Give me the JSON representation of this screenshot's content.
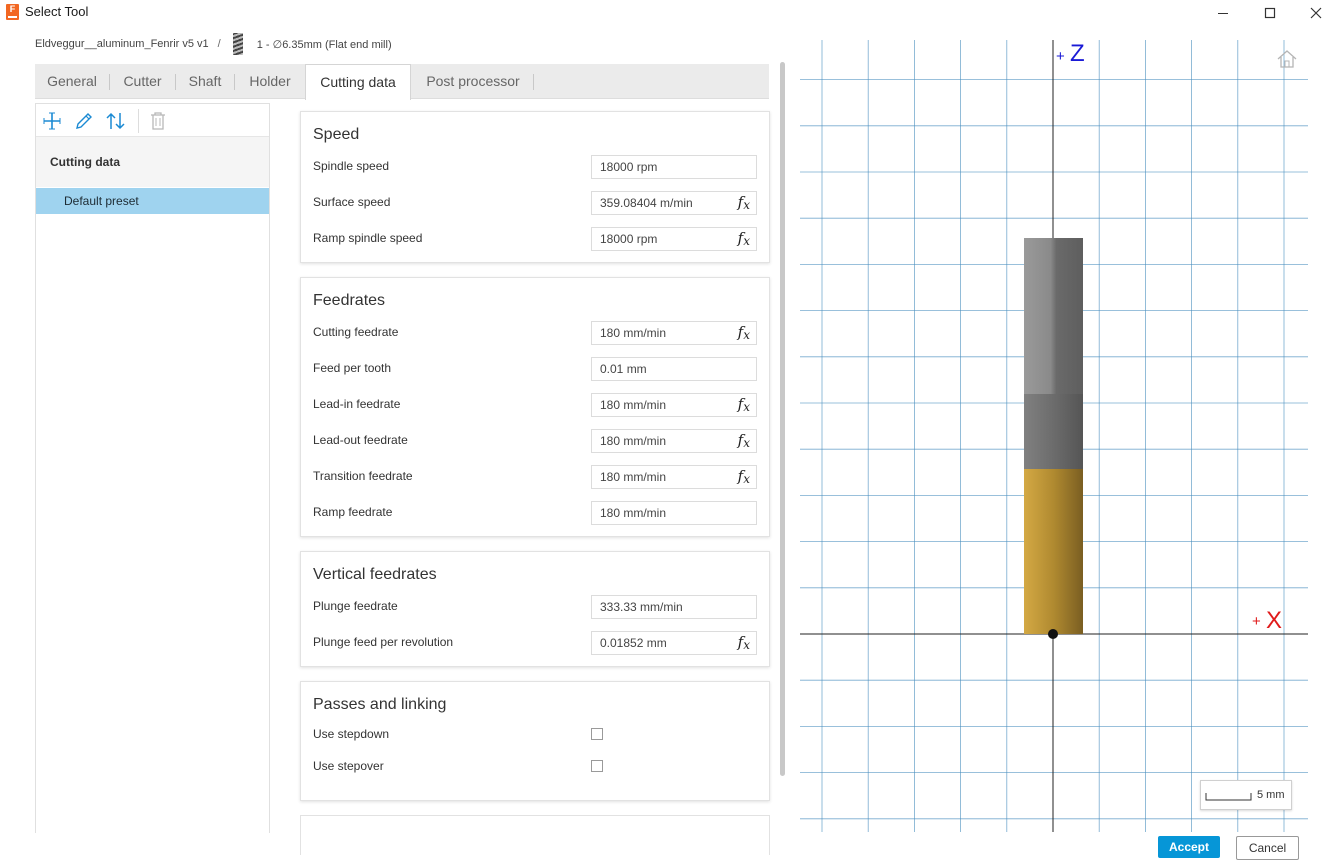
{
  "window": {
    "title": "Select Tool",
    "app_icon_letter": "F"
  },
  "breadcrumb": {
    "document": "Eldveggur__aluminum_Fenrir v5 v1",
    "separator": "/",
    "tool": "1 - ∅6.35mm (Flat end mill)"
  },
  "tabs": [
    {
      "label": "General"
    },
    {
      "label": "Cutter"
    },
    {
      "label": "Shaft"
    },
    {
      "label": "Holder"
    },
    {
      "label": "Cutting data",
      "active": true
    },
    {
      "label": "Post processor"
    }
  ],
  "presets": {
    "toolbar_icons": [
      "add-icon",
      "edit-icon",
      "sort-icon",
      "delete-icon"
    ],
    "group_label": "Cutting data",
    "items": [
      {
        "label": "Default preset",
        "selected": true
      }
    ]
  },
  "sections": {
    "speed": {
      "title": "Speed",
      "rows": [
        {
          "label": "Spindle speed",
          "value": "18000 rpm",
          "fx": false
        },
        {
          "label": "Surface speed",
          "value": "359.08404 m/min",
          "fx": true
        },
        {
          "label": "Ramp spindle speed",
          "value": "18000 rpm",
          "fx": true
        }
      ]
    },
    "feedrates": {
      "title": "Feedrates",
      "rows": [
        {
          "label": "Cutting feedrate",
          "value": "180 mm/min",
          "fx": true
        },
        {
          "label": "Feed per tooth",
          "value": "0.01 mm",
          "fx": false
        },
        {
          "label": "Lead-in feedrate",
          "value": "180 mm/min",
          "fx": true
        },
        {
          "label": "Lead-out feedrate",
          "value": "180 mm/min",
          "fx": true
        },
        {
          "label": "Transition feedrate",
          "value": "180 mm/min",
          "fx": true
        },
        {
          "label": "Ramp feedrate",
          "value": "180 mm/min",
          "fx": false
        }
      ]
    },
    "vertical": {
      "title": "Vertical feedrates",
      "rows": [
        {
          "label": "Plunge feedrate",
          "value": "333.33 mm/min",
          "fx": false
        },
        {
          "label": "Plunge feed per revolution",
          "value": "0.01852 mm",
          "fx": true
        }
      ]
    },
    "passes": {
      "title": "Passes and linking",
      "rows": [
        {
          "label": "Use stepdown",
          "checked": false
        },
        {
          "label": "Use stepover",
          "checked": false
        }
      ]
    }
  },
  "fx_label": "f",
  "fx_sub": "x",
  "viewport": {
    "axis_z": "Z",
    "axis_x": "X",
    "axis_sign": "+",
    "scale_label": "5 mm",
    "colors": {
      "grid": "#4a8fbf",
      "axis_z": "#1a1ad6",
      "axis_x": "#e01b1b",
      "holder": "#7a7a7a",
      "shaft": "#666666",
      "flutes": "#c9a034"
    }
  },
  "buttons": {
    "accept": "Accept",
    "cancel": "Cancel"
  }
}
